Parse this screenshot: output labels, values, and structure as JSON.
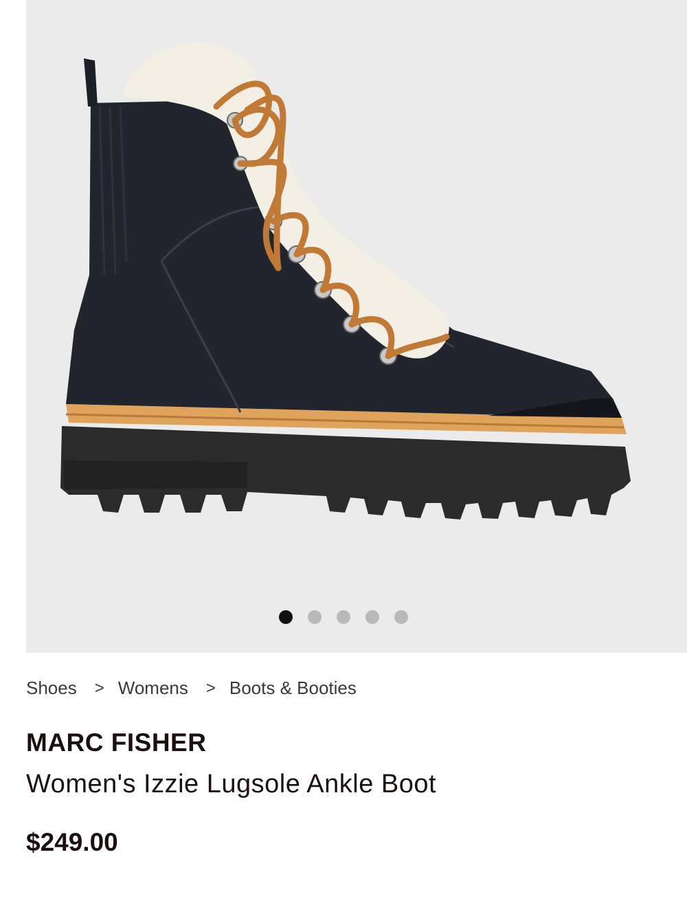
{
  "gallery": {
    "image_alt": "Women's Izzie Lugsole Ankle Boot",
    "dot_count": 5,
    "active_index": 0
  },
  "breadcrumb": {
    "items": [
      "Shoes",
      "Womens",
      "Boots & Booties"
    ],
    "separator": ">"
  },
  "product": {
    "brand": "MARC FISHER",
    "name": "Women's Izzie Lugsole Ankle Boot",
    "price": "$249.00"
  },
  "colors": {
    "gallery_bg": "#ebebeb",
    "leather": "#23252e",
    "laces": "#c07a35",
    "shearling": "#f3efe4",
    "welt": "#e0a35c",
    "sole": "#2b2b2b",
    "active_dot": "#111111",
    "inactive_dot": "#b9b9b9"
  }
}
